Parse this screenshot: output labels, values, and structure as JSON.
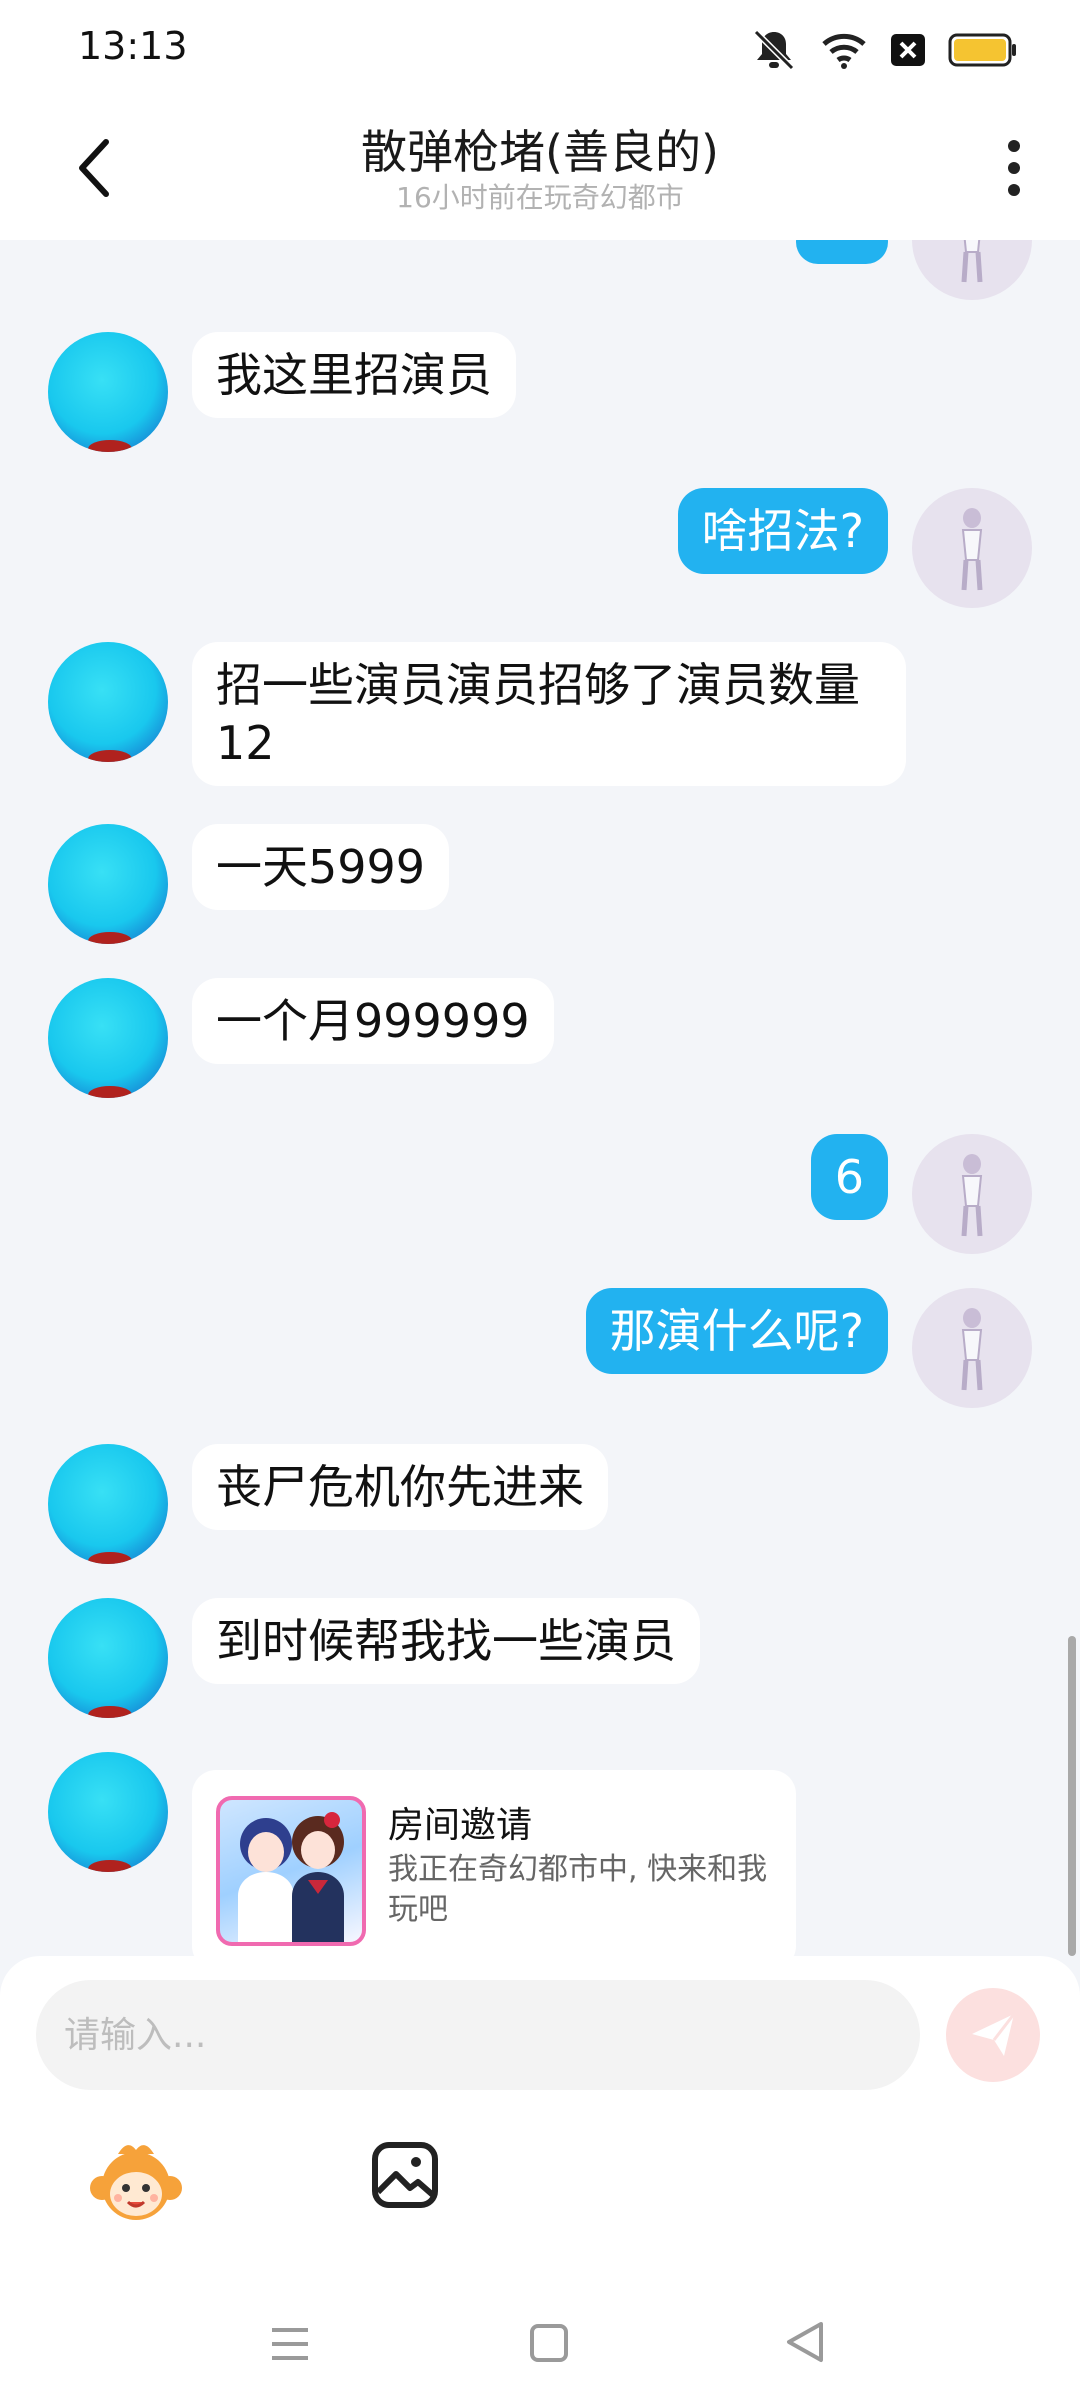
{
  "status_bar": {
    "time": "13:13",
    "icons": [
      "mute-bell-icon",
      "wifi-icon",
      "sim-x-icon",
      "battery-icon"
    ]
  },
  "header": {
    "back_icon": "chevron-left-icon",
    "title": "散弹枪堵(善良的)",
    "subtitle": "16小时前在玩奇幻都市",
    "more_icon": "more-vertical-icon"
  },
  "messages": [
    {
      "from": "other",
      "text": "我这里招演员"
    },
    {
      "from": "me",
      "text": "啥招法?"
    },
    {
      "from": "other",
      "text": "招一些演员演员招够了演员数量\n12"
    },
    {
      "from": "other",
      "text": "一天5999"
    },
    {
      "from": "other",
      "text": "一个月999999"
    },
    {
      "from": "me",
      "text": "6"
    },
    {
      "from": "me",
      "text": "那演什么呢?"
    },
    {
      "from": "other",
      "text": "丧尸危机你先进来"
    },
    {
      "from": "other",
      "text": "到时候帮我找一些演员"
    }
  ],
  "invite_card": {
    "title": "房间邀请",
    "description": "我正在奇幻都市中, 快来和我玩吧"
  },
  "input": {
    "placeholder": "请输入..."
  },
  "colors": {
    "my_bubble": "#22b2f0",
    "background": "#f3f5f9",
    "send_button": "#fce0df"
  }
}
